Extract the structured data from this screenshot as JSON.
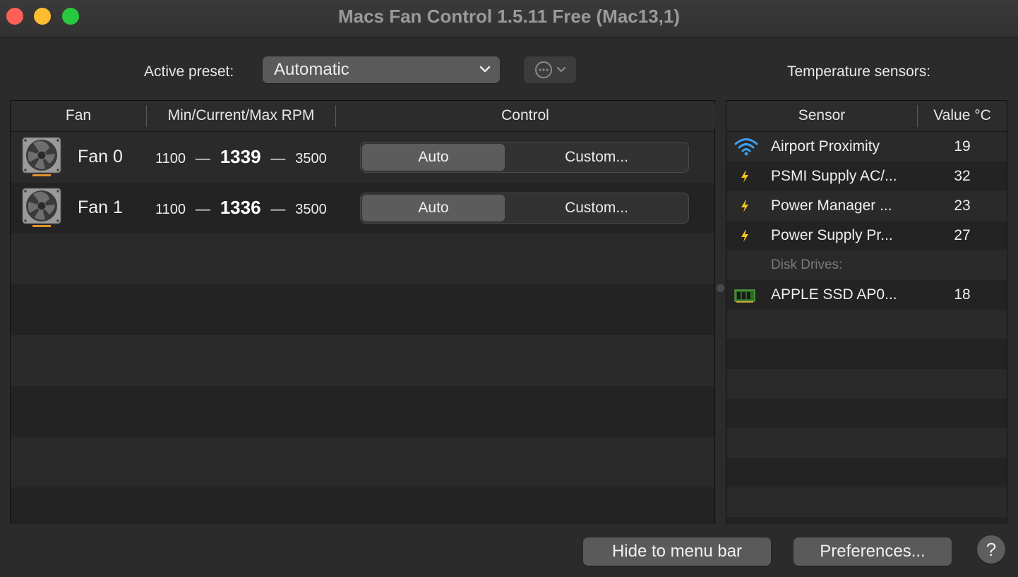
{
  "window": {
    "title": "Macs Fan Control 1.5.11 Free (Mac13,1)"
  },
  "preset": {
    "label": "Active preset:",
    "value": "Automatic"
  },
  "sensors_label": "Temperature sensors:",
  "fan_table": {
    "columns": [
      "Fan",
      "Min/Current/Max RPM",
      "Control"
    ],
    "rows": [
      {
        "name": "Fan 0",
        "min": "1100",
        "current": "1339",
        "max": "3500",
        "auto_label": "Auto",
        "custom_label": "Custom...",
        "selected": "Auto"
      },
      {
        "name": "Fan 1",
        "min": "1100",
        "current": "1336",
        "max": "3500",
        "auto_label": "Auto",
        "custom_label": "Custom...",
        "selected": "Auto"
      }
    ],
    "dash": "—"
  },
  "sensor_table": {
    "columns": [
      "Sensor",
      "Value °C"
    ],
    "rows": [
      {
        "icon": "wifi-icon",
        "name": "Airport Proximity",
        "value": "19"
      },
      {
        "icon": "lightning-icon",
        "name": "PSMI Supply AC/...",
        "value": "32"
      },
      {
        "icon": "lightning-icon",
        "name": "Power Manager ...",
        "value": "23"
      },
      {
        "icon": "lightning-icon",
        "name": "Power Supply Pr...",
        "value": "27"
      }
    ],
    "group_label": "Disk Drives:",
    "disk_rows": [
      {
        "icon": "ssd-icon",
        "name": "APPLE SSD AP0...",
        "value": "18"
      }
    ]
  },
  "footer": {
    "hide_label": "Hide to menu bar",
    "preferences_label": "Preferences...",
    "help_label": "?"
  },
  "colors": {
    "close": "#fe5f57",
    "minimize": "#febc2e",
    "maximize": "#28c840",
    "wifi": "#3d9ff5",
    "lightning": "#f5c518",
    "ssd": "#3f9b2f"
  }
}
